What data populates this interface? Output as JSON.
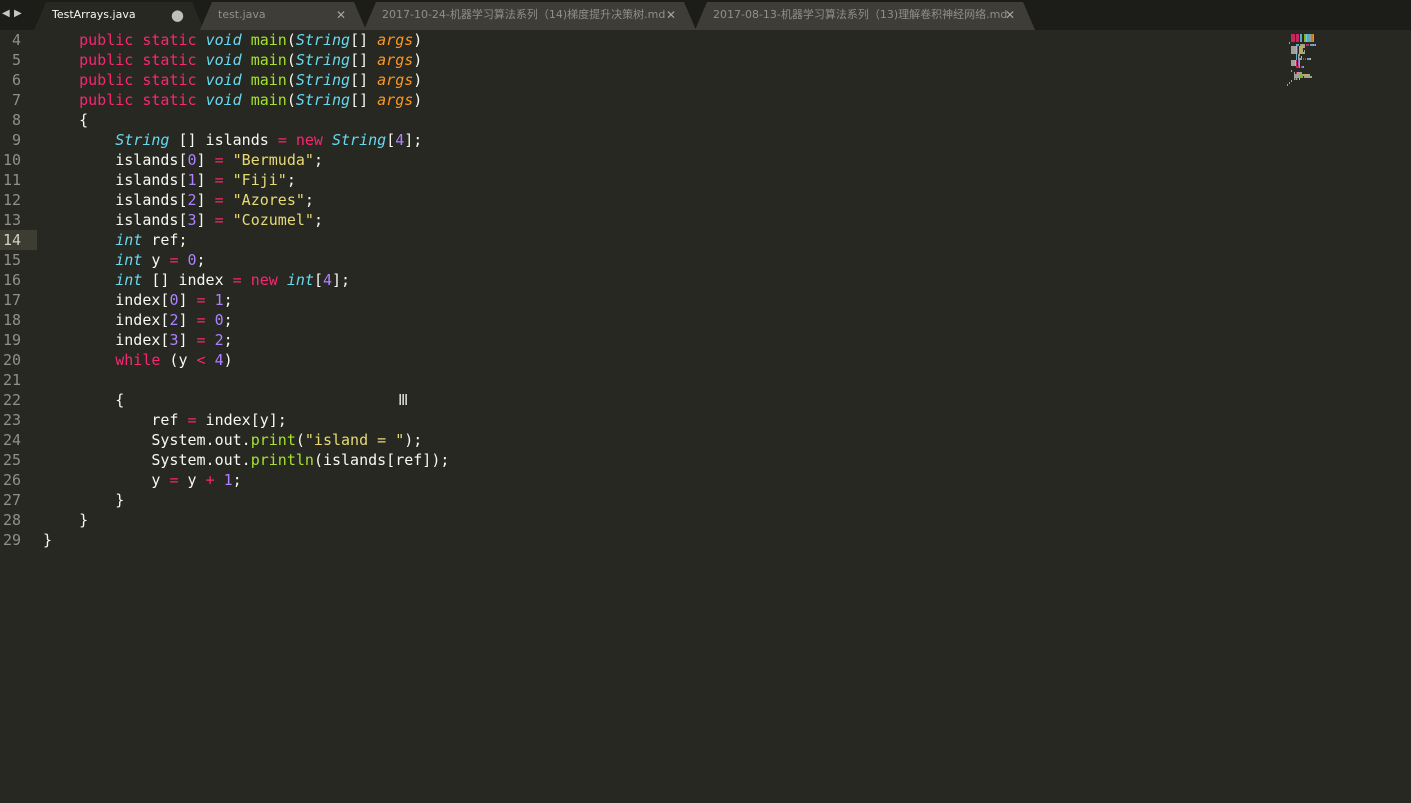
{
  "tabbar": {
    "nav_left_icon": "triangle-left-icon",
    "nav_right_icon": "triangle-right-icon",
    "tabs": [
      {
        "label": "TestArrays.java",
        "active": true,
        "modified": true
      },
      {
        "label": "test.java",
        "active": false,
        "modified": false
      },
      {
        "label": "2017-10-24-机器学习算法系列（14)梯度提升决策树.md",
        "active": false,
        "modified": false
      },
      {
        "label": "2017-08-13-机器学习算法系列（13)理解卷积神经网络.md",
        "active": false,
        "modified": false
      }
    ]
  },
  "editor": {
    "current_line": "14",
    "theme_colors": {
      "background": "#272822",
      "keyword": "#f92672",
      "type": "#66d9ef",
      "function": "#a6e22e",
      "parameter": "#fd971f",
      "number": "#ae81ff",
      "string": "#e6db74"
    },
    "lines": [
      {
        "n": "4",
        "tokens": [
          [
            "",
            "    "
          ],
          [
            "k",
            "public"
          ],
          [
            "",
            " "
          ],
          [
            "k",
            "static"
          ],
          [
            "",
            " "
          ],
          [
            "t",
            "void"
          ],
          [
            "",
            " "
          ],
          [
            "f",
            "main"
          ],
          [
            "",
            "("
          ],
          [
            "t",
            "String"
          ],
          [
            "",
            "[] "
          ],
          [
            "p",
            "args"
          ],
          [
            "",
            ")"
          ]
        ]
      },
      {
        "n": "5",
        "tokens": [
          [
            "",
            "    "
          ],
          [
            "k",
            "public"
          ],
          [
            "",
            " "
          ],
          [
            "k",
            "static"
          ],
          [
            "",
            " "
          ],
          [
            "t",
            "void"
          ],
          [
            "",
            " "
          ],
          [
            "f",
            "main"
          ],
          [
            "",
            "("
          ],
          [
            "t",
            "String"
          ],
          [
            "",
            "[] "
          ],
          [
            "p",
            "args"
          ],
          [
            "",
            ")"
          ]
        ]
      },
      {
        "n": "6",
        "tokens": [
          [
            "",
            "    "
          ],
          [
            "k",
            "public"
          ],
          [
            "",
            " "
          ],
          [
            "k",
            "static"
          ],
          [
            "",
            " "
          ],
          [
            "t",
            "void"
          ],
          [
            "",
            " "
          ],
          [
            "f",
            "main"
          ],
          [
            "",
            "("
          ],
          [
            "t",
            "String"
          ],
          [
            "",
            "[] "
          ],
          [
            "p",
            "args"
          ],
          [
            "",
            ")"
          ]
        ]
      },
      {
        "n": "7",
        "tokens": [
          [
            "",
            "    "
          ],
          [
            "k",
            "public"
          ],
          [
            "",
            " "
          ],
          [
            "k",
            "static"
          ],
          [
            "",
            " "
          ],
          [
            "t",
            "void"
          ],
          [
            "",
            " "
          ],
          [
            "f",
            "main"
          ],
          [
            "",
            "("
          ],
          [
            "t",
            "String"
          ],
          [
            "",
            "[] "
          ],
          [
            "p",
            "args"
          ],
          [
            "",
            ")"
          ]
        ]
      },
      {
        "n": "8",
        "tokens": [
          [
            "",
            "    {"
          ]
        ]
      },
      {
        "n": "9",
        "tokens": [
          [
            "",
            "        "
          ],
          [
            "t",
            "String"
          ],
          [
            "",
            " [] islands "
          ],
          [
            "o",
            "="
          ],
          [
            "",
            " "
          ],
          [
            "k",
            "new"
          ],
          [
            "",
            " "
          ],
          [
            "t",
            "String"
          ],
          [
            "",
            "["
          ],
          [
            "n",
            "4"
          ],
          [
            "",
            "];"
          ]
        ]
      },
      {
        "n": "10",
        "tokens": [
          [
            "",
            "        islands["
          ],
          [
            "n",
            "0"
          ],
          [
            "",
            "] "
          ],
          [
            "o",
            "="
          ],
          [
            "",
            " "
          ],
          [
            "s",
            "\"Bermuda\""
          ],
          [
            "",
            ";"
          ]
        ]
      },
      {
        "n": "11",
        "tokens": [
          [
            "",
            "        islands["
          ],
          [
            "n",
            "1"
          ],
          [
            "",
            "] "
          ],
          [
            "o",
            "="
          ],
          [
            "",
            " "
          ],
          [
            "s",
            "\"Fiji\""
          ],
          [
            "",
            ";"
          ]
        ]
      },
      {
        "n": "12",
        "tokens": [
          [
            "",
            "        islands["
          ],
          [
            "n",
            "2"
          ],
          [
            "",
            "] "
          ],
          [
            "o",
            "="
          ],
          [
            "",
            " "
          ],
          [
            "s",
            "\"Azores\""
          ],
          [
            "",
            ";"
          ]
        ]
      },
      {
        "n": "13",
        "tokens": [
          [
            "",
            "        islands["
          ],
          [
            "n",
            "3"
          ],
          [
            "",
            "] "
          ],
          [
            "o",
            "="
          ],
          [
            "",
            " "
          ],
          [
            "s",
            "\"Cozumel\""
          ],
          [
            "",
            ";"
          ]
        ]
      },
      {
        "n": "14",
        "tokens": [
          [
            "",
            "        "
          ],
          [
            "t",
            "int"
          ],
          [
            "",
            " ref;"
          ]
        ]
      },
      {
        "n": "15",
        "tokens": [
          [
            "",
            "        "
          ],
          [
            "t",
            "int"
          ],
          [
            "",
            " y "
          ],
          [
            "o",
            "="
          ],
          [
            "",
            " "
          ],
          [
            "n",
            "0"
          ],
          [
            "",
            ";"
          ]
        ]
      },
      {
        "n": "16",
        "tokens": [
          [
            "",
            "        "
          ],
          [
            "t",
            "int"
          ],
          [
            "",
            " [] index "
          ],
          [
            "o",
            "="
          ],
          [
            "",
            " "
          ],
          [
            "k",
            "new"
          ],
          [
            "",
            " "
          ],
          [
            "t",
            "int"
          ],
          [
            "",
            "["
          ],
          [
            "n",
            "4"
          ],
          [
            "",
            "];"
          ]
        ]
      },
      {
        "n": "17",
        "tokens": [
          [
            "",
            "        index["
          ],
          [
            "n",
            "0"
          ],
          [
            "",
            "] "
          ],
          [
            "o",
            "="
          ],
          [
            "",
            " "
          ],
          [
            "n",
            "1"
          ],
          [
            "",
            ";"
          ]
        ]
      },
      {
        "n": "18",
        "tokens": [
          [
            "",
            "        index["
          ],
          [
            "n",
            "2"
          ],
          [
            "",
            "] "
          ],
          [
            "o",
            "="
          ],
          [
            "",
            " "
          ],
          [
            "n",
            "0"
          ],
          [
            "",
            ";"
          ]
        ]
      },
      {
        "n": "19",
        "tokens": [
          [
            "",
            "        index["
          ],
          [
            "n",
            "3"
          ],
          [
            "",
            "] "
          ],
          [
            "o",
            "="
          ],
          [
            "",
            " "
          ],
          [
            "n",
            "2"
          ],
          [
            "",
            ";"
          ]
        ]
      },
      {
        "n": "20",
        "tokens": [
          [
            "",
            "        "
          ],
          [
            "k",
            "while"
          ],
          [
            "",
            " (y "
          ],
          [
            "o",
            "<"
          ],
          [
            "",
            " "
          ],
          [
            "n",
            "4"
          ],
          [
            "",
            ")"
          ]
        ]
      },
      {
        "n": "21",
        "tokens": []
      },
      {
        "n": "22",
        "tokens": [
          [
            "",
            "        {"
          ]
        ]
      },
      {
        "n": "23",
        "tokens": [
          [
            "",
            "            ref "
          ],
          [
            "o",
            "="
          ],
          [
            "",
            " index[y];"
          ]
        ]
      },
      {
        "n": "24",
        "tokens": [
          [
            "",
            "            System.out."
          ],
          [
            "f",
            "print"
          ],
          [
            "",
            "("
          ],
          [
            "s",
            "\"island = \""
          ],
          [
            "",
            ");"
          ]
        ]
      },
      {
        "n": "25",
        "tokens": [
          [
            "",
            "            System.out."
          ],
          [
            "f",
            "println"
          ],
          [
            "",
            "(islands[ref]);"
          ]
        ]
      },
      {
        "n": "26",
        "tokens": [
          [
            "",
            "            y "
          ],
          [
            "o",
            "="
          ],
          [
            "",
            " y "
          ],
          [
            "o",
            "+"
          ],
          [
            "",
            " "
          ],
          [
            "n",
            "1"
          ],
          [
            "",
            ";"
          ]
        ]
      },
      {
        "n": "27",
        "tokens": [
          [
            "",
            "        }"
          ]
        ]
      },
      {
        "n": "28",
        "tokens": [
          [
            "",
            "    }"
          ]
        ]
      },
      {
        "n": "29",
        "tokens": [
          [
            "",
            "}"
          ]
        ]
      }
    ]
  },
  "minimap": {
    "icon": "minimap-preview"
  },
  "cursor": {
    "icon": "ibeam-cursor-icon"
  }
}
